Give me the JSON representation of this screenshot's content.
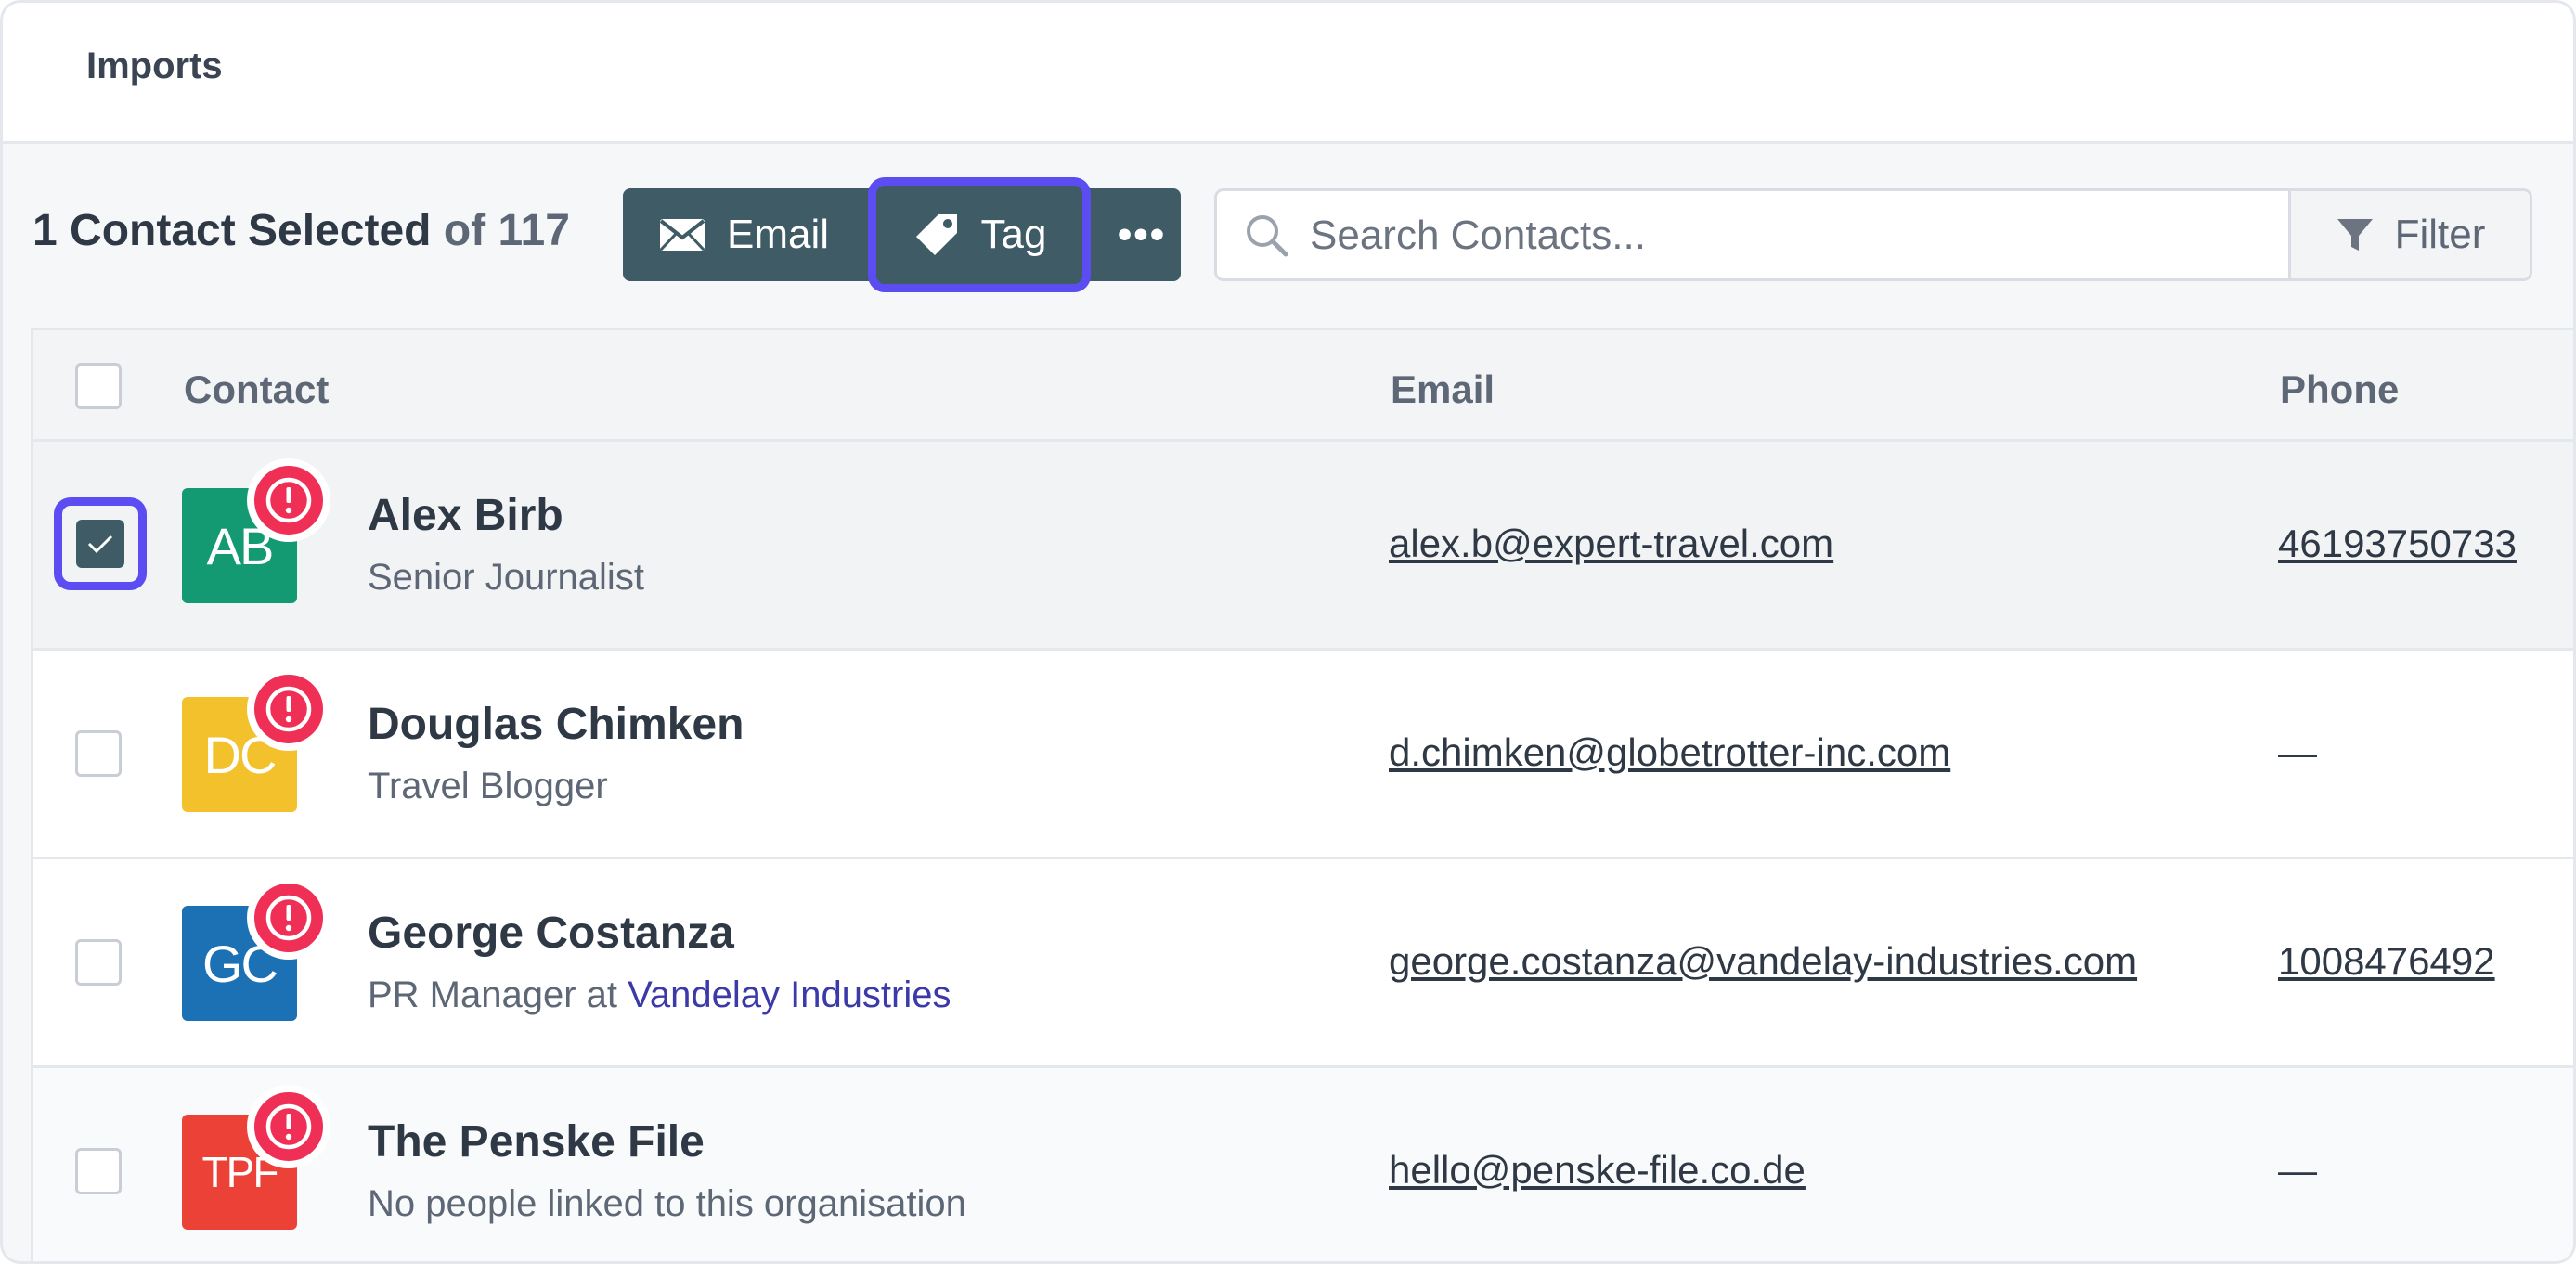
{
  "header": {
    "title": "Imports"
  },
  "toolbar": {
    "selected_prefix": "1 Contact Selected",
    "selected_suffix": "of 117",
    "email_label": "Email",
    "tag_label": "Tag",
    "more_label": "•••",
    "search_placeholder": "Search Contacts...",
    "search_value": "",
    "filter_label": "Filter"
  },
  "table": {
    "columns": {
      "contact": "Contact",
      "email": "Email",
      "phone": "Phone"
    },
    "rows": [
      {
        "initials": "AB",
        "avatar_color": "#149a72",
        "name": "Alex Birb",
        "subtitle": "Senior Journalist",
        "subtitle_org": "",
        "email": "alex.b@expert-travel.com",
        "phone": "46193750733",
        "selected": true
      },
      {
        "initials": "DC",
        "avatar_color": "#f3c12c",
        "name": "Douglas Chimken",
        "subtitle": "Travel Blogger",
        "subtitle_org": "",
        "email": "d.chimken@globetrotter-inc.com",
        "phone": "—",
        "selected": false
      },
      {
        "initials": "GC",
        "avatar_color": "#1c70b4",
        "name": "George Costanza",
        "subtitle": "PR Manager at ",
        "subtitle_org": "Vandelay Industries",
        "email": "george.costanza@vandelay-industries.com",
        "phone": "1008476492",
        "selected": false
      },
      {
        "initials": "TPF",
        "avatar_color": "#ec4136",
        "name": "The Penske File",
        "subtitle": "No people linked to this organisation",
        "subtitle_org": "",
        "email": "hello@penske-file.co.de",
        "phone": "—",
        "selected": false
      }
    ]
  },
  "colors": {
    "accent": "#5b4df2",
    "toolbar": "#3e5b66",
    "warning": "#ef2f55"
  },
  "icons": [
    "envelope-icon",
    "tag-icon",
    "more-icon",
    "search-icon",
    "filter-icon",
    "check-icon",
    "warning-icon"
  ]
}
